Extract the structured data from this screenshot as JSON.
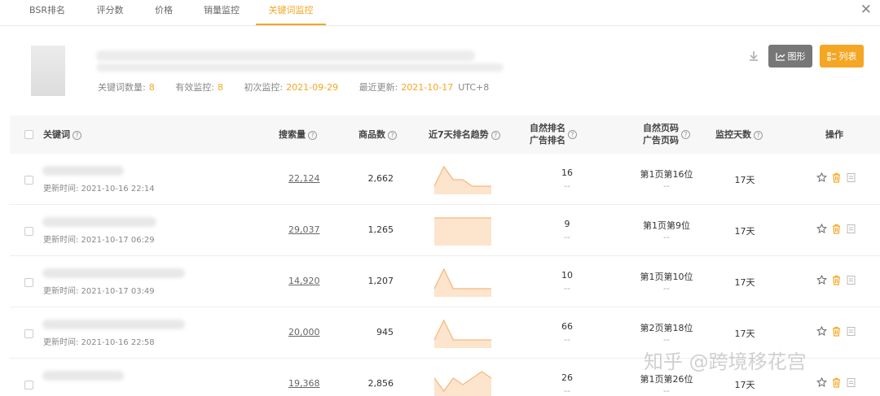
{
  "tabs": [
    {
      "label": "BSR排名"
    },
    {
      "label": "评分数"
    },
    {
      "label": "价格"
    },
    {
      "label": "销量监控"
    },
    {
      "label": "关键词监控"
    }
  ],
  "close_icon": "close-icon",
  "stats": {
    "keyword_count_label": "关键词数量:",
    "keyword_count": "8",
    "valid_label": "有效监控:",
    "valid": "8",
    "first_label": "初次监控:",
    "first": "2021-09-29",
    "recent_label": "最近更新:",
    "recent": "2021-10-17",
    "tz": "UTC+8"
  },
  "buttons": {
    "chart": "图形",
    "list": "列表"
  },
  "table": {
    "headers": {
      "keyword": "关键词",
      "search": "搜索量",
      "products": "商品数",
      "trend": "近7天排名趋势",
      "organic_rank": "自然排名",
      "ad_rank": "广告排名",
      "organic_page": "自然页码",
      "ad_page": "广告页码",
      "days": "监控天数",
      "ops": "操作"
    },
    "rows": [
      {
        "updated": "更新时间: 2021-10-16 22:14",
        "search": "22,124",
        "products": "2,662",
        "rank": "16",
        "ad": "--",
        "page": "第1页第16位",
        "ad_page": "--",
        "days": "17天",
        "trend": [
          5,
          2,
          4,
          4,
          5,
          5,
          5
        ]
      },
      {
        "updated": "更新时间: 2021-10-17 06:29",
        "search": "29,037",
        "products": "1,265",
        "rank": "9",
        "ad": "--",
        "page": "第1页第9位",
        "ad_page": "--",
        "days": "17天",
        "trend": [
          9,
          9,
          9,
          9,
          9,
          9,
          9
        ]
      },
      {
        "updated": "更新时间: 2021-10-17 03:49",
        "search": "14,920",
        "products": "1,207",
        "rank": "10",
        "ad": "--",
        "page": "第1页第10位",
        "ad_page": "--",
        "days": "17天",
        "trend": [
          10,
          9,
          10,
          10,
          10,
          10,
          10
        ]
      },
      {
        "updated": "更新时间: 2021-10-16 22:58",
        "search": "20,000",
        "products": "945",
        "rank": "66",
        "ad": "--",
        "page": "第2页第18位",
        "ad_page": "--",
        "days": "17天",
        "trend": [
          66,
          62,
          66,
          66,
          66,
          66,
          66
        ]
      },
      {
        "updated": "",
        "search": "19,368",
        "products": "2,856",
        "rank": "26",
        "ad": "--",
        "page": "第1页第26位",
        "ad_page": "--",
        "days": "17天",
        "trend": [
          26,
          28,
          26,
          27,
          26,
          25,
          26
        ]
      }
    ]
  },
  "watermark": "知乎 @跨境移花宫",
  "colors": {
    "accent": "#f5a623",
    "button_gray": "#777777"
  }
}
